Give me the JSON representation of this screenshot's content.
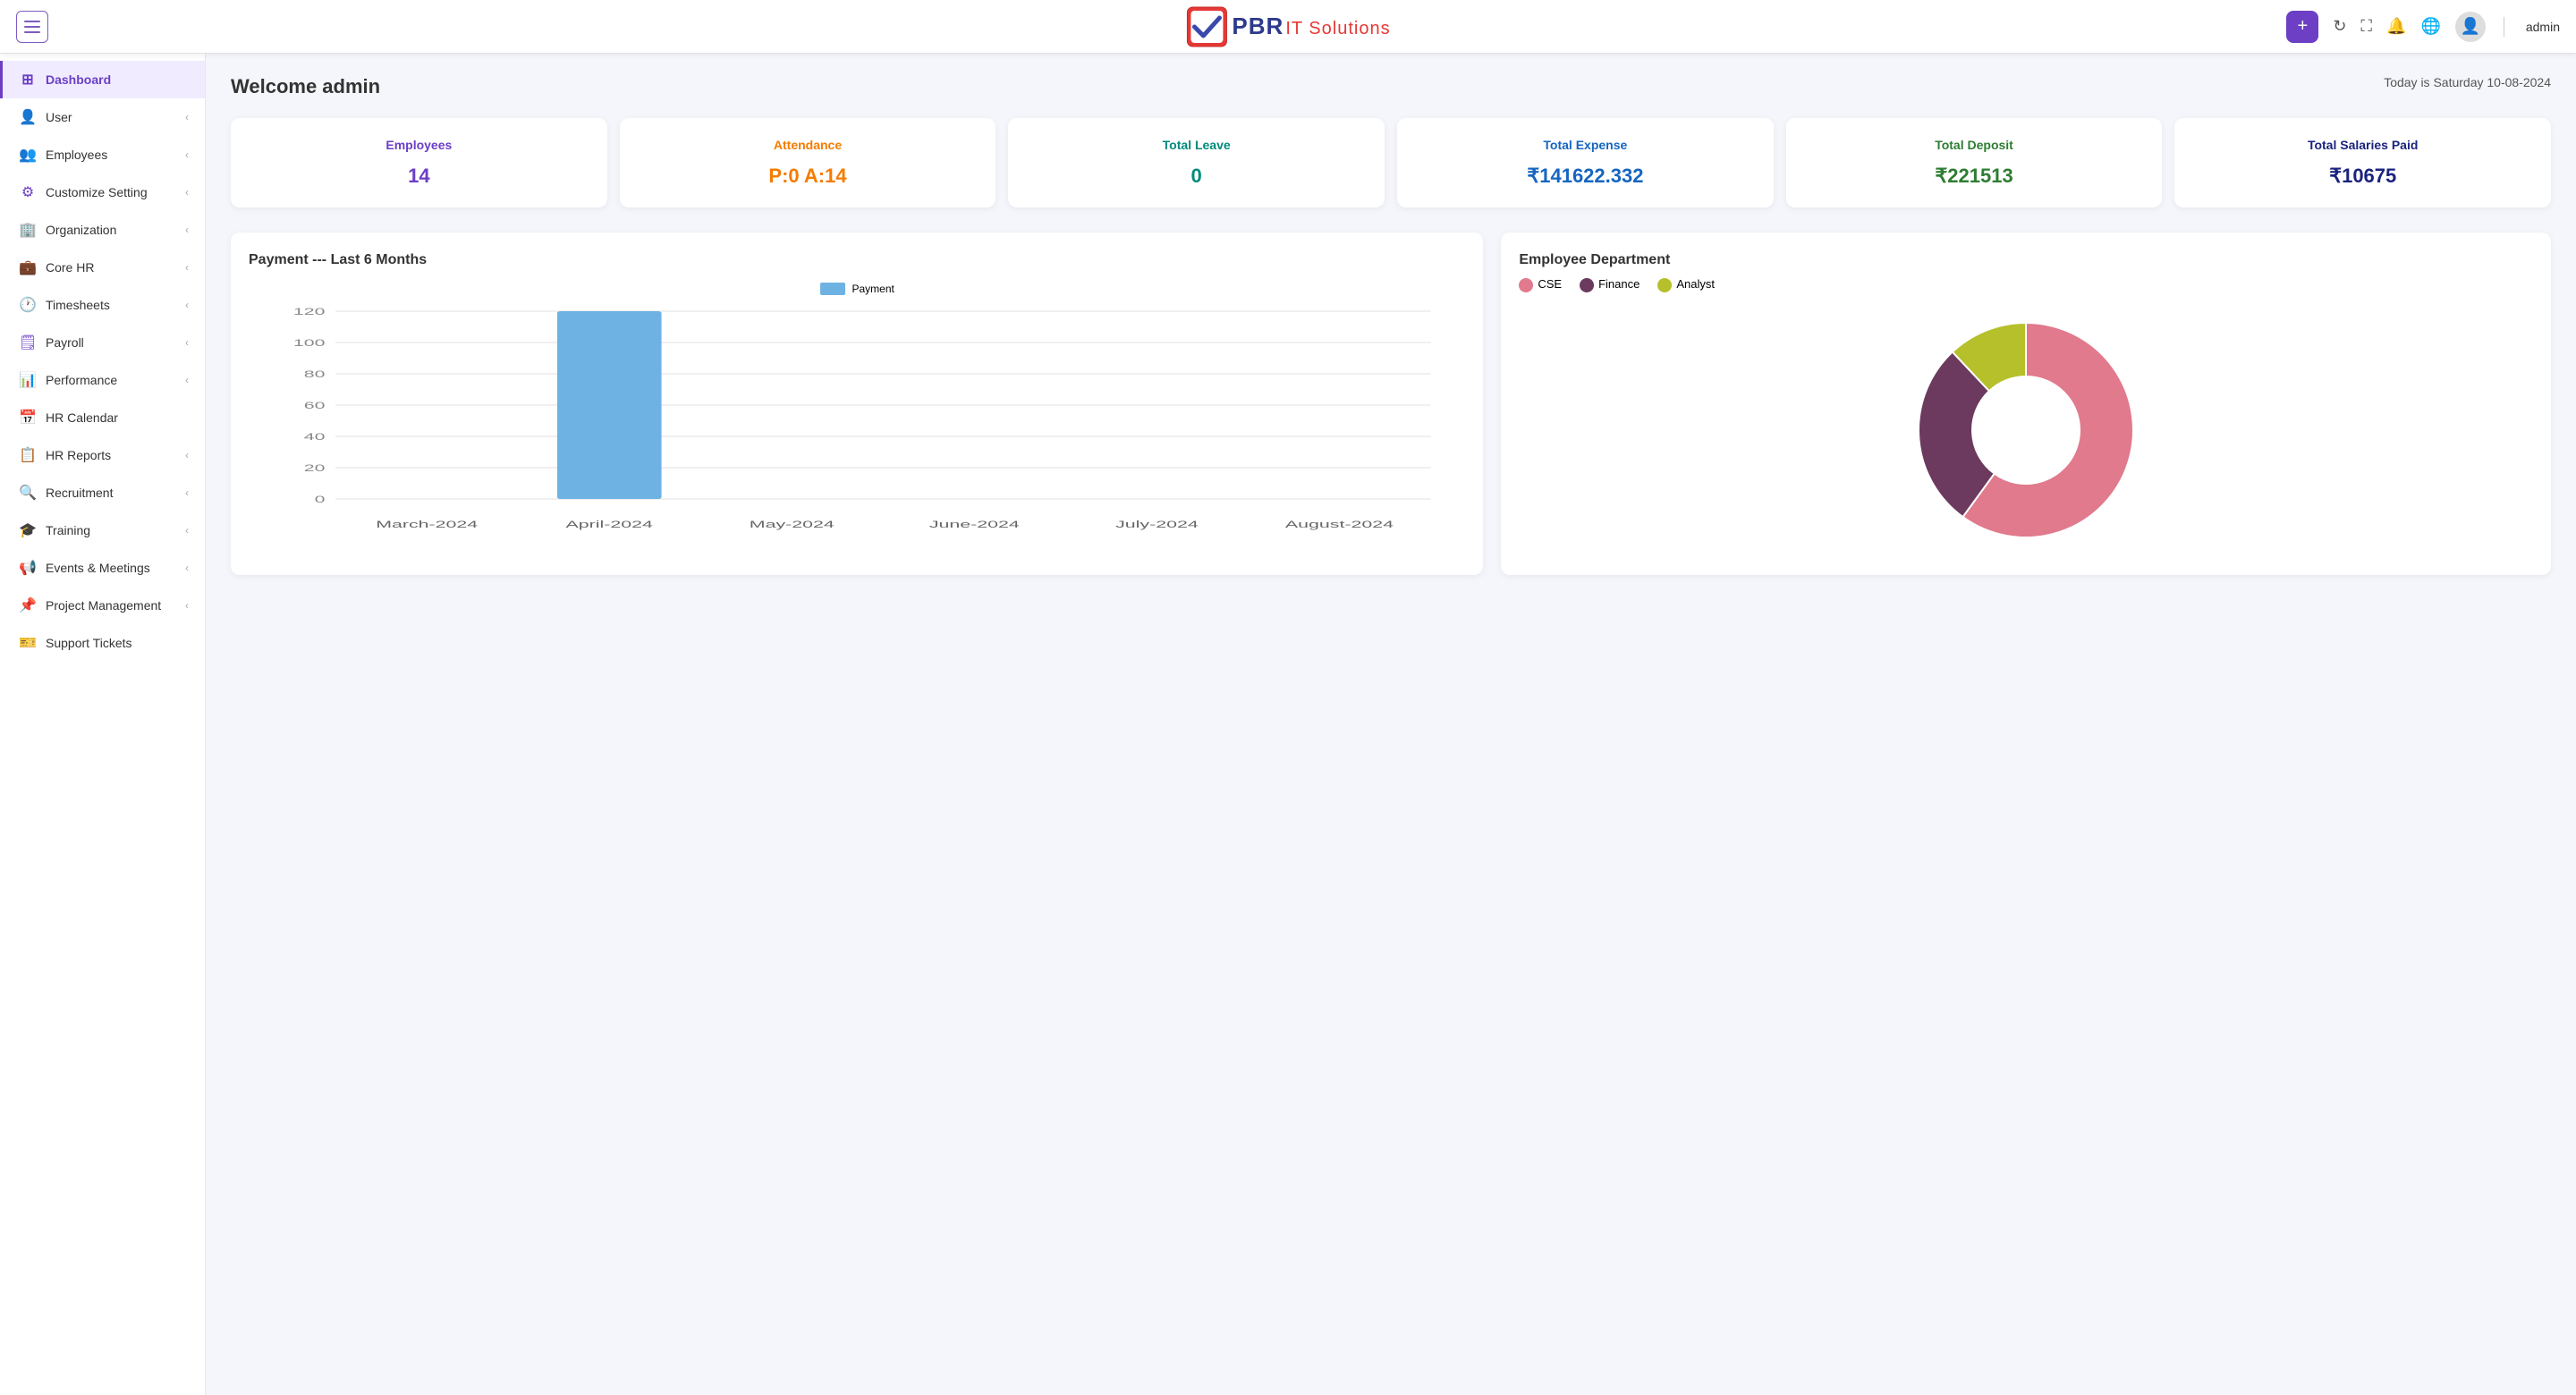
{
  "app": {
    "title": "PBR IT Solutions",
    "admin_label": "admin"
  },
  "topnav": {
    "add_button_label": "+",
    "date_text": "Today is Saturday 10-08-2024"
  },
  "welcome": {
    "title": "Welcome admin",
    "date": "Today is Saturday 10-08-2024"
  },
  "stat_cards": [
    {
      "label": "Employees",
      "value": "14",
      "color": "color-purple"
    },
    {
      "label": "Attendance",
      "value": "P:0 A:14",
      "color": "color-orange"
    },
    {
      "label": "Total Leave",
      "value": "0",
      "color": "color-teal"
    },
    {
      "label": "Total Expense",
      "value": "₹141622.332",
      "color": "color-blue"
    },
    {
      "label": "Total Deposit",
      "value": "₹221513",
      "color": "color-green"
    },
    {
      "label": "Total Salaries Paid",
      "value": "₹10675",
      "color": "color-darkblue"
    }
  ],
  "payment_chart": {
    "title": "Payment --- Last 6 Months",
    "legend": "Payment",
    "months": [
      "March-2024",
      "April-2024",
      "May-2024",
      "June-2024",
      "July-2024",
      "August-2024"
    ],
    "values": [
      0,
      120,
      0,
      0,
      0,
      0
    ],
    "y_labels": [
      "0",
      "20",
      "40",
      "60",
      "80",
      "100",
      "120"
    ],
    "bar_color": "#6eb2e4"
  },
  "dept_chart": {
    "title": "Employee Department",
    "legend": [
      {
        "label": "CSE",
        "color": "#e07a8c"
      },
      {
        "label": "Finance",
        "color": "#6b3a5e"
      },
      {
        "label": "Analyst",
        "color": "#b5c02a"
      }
    ],
    "segments": [
      {
        "dept": "CSE",
        "percent": 60,
        "color": "#e07a8c"
      },
      {
        "dept": "Finance",
        "percent": 28,
        "color": "#6b3a5e"
      },
      {
        "dept": "Analyst",
        "percent": 12,
        "color": "#b5c02a"
      }
    ]
  },
  "sidebar": {
    "items": [
      {
        "id": "dashboard",
        "label": "Dashboard",
        "icon": "⊞",
        "active": true,
        "has_chevron": false
      },
      {
        "id": "user",
        "label": "User",
        "icon": "👤",
        "active": false,
        "has_chevron": true
      },
      {
        "id": "employees",
        "label": "Employees",
        "icon": "👥",
        "active": false,
        "has_chevron": true
      },
      {
        "id": "customize-setting",
        "label": "Customize Setting",
        "icon": "⚙",
        "active": false,
        "has_chevron": true
      },
      {
        "id": "organization",
        "label": "Organization",
        "icon": "🏢",
        "active": false,
        "has_chevron": true
      },
      {
        "id": "core-hr",
        "label": "Core HR",
        "icon": "💼",
        "active": false,
        "has_chevron": true
      },
      {
        "id": "timesheets",
        "label": "Timesheets",
        "icon": "🕐",
        "active": false,
        "has_chevron": true
      },
      {
        "id": "payroll",
        "label": "Payroll",
        "icon": "🗒",
        "active": false,
        "has_chevron": true
      },
      {
        "id": "performance",
        "label": "Performance",
        "icon": "📊",
        "active": false,
        "has_chevron": true
      },
      {
        "id": "hr-calendar",
        "label": "HR Calendar",
        "icon": "📅",
        "active": false,
        "has_chevron": false
      },
      {
        "id": "hr-reports",
        "label": "HR Reports",
        "icon": "📋",
        "active": false,
        "has_chevron": true
      },
      {
        "id": "recruitment",
        "label": "Recruitment",
        "icon": "🔍",
        "active": false,
        "has_chevron": true
      },
      {
        "id": "training",
        "label": "Training",
        "icon": "🎓",
        "active": false,
        "has_chevron": true
      },
      {
        "id": "events-meetings",
        "label": "Events & Meetings",
        "icon": "📢",
        "active": false,
        "has_chevron": true
      },
      {
        "id": "project-management",
        "label": "Project Management",
        "icon": "📌",
        "active": false,
        "has_chevron": true
      },
      {
        "id": "support-tickets",
        "label": "Support Tickets",
        "icon": "🎫",
        "active": false,
        "has_chevron": false
      }
    ]
  }
}
